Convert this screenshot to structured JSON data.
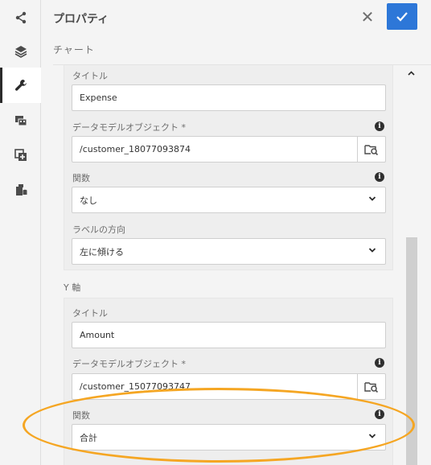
{
  "rail": {
    "items": [
      {
        "icon": "share-icon"
      },
      {
        "icon": "layers-icon"
      },
      {
        "icon": "wrench-icon"
      },
      {
        "icon": "media-icon"
      },
      {
        "icon": "add-component-icon"
      },
      {
        "icon": "data-icon"
      }
    ],
    "active_index": 2
  },
  "header": {
    "title": "プロパティ",
    "close_label": "✕",
    "confirm_label": "✓"
  },
  "section_tab": "チャート",
  "x_axis": {
    "title_label": "タイトル",
    "title_value": "Expense",
    "dmo_label": "データモデルオブジェクト *",
    "dmo_value": "/customer_18077093874",
    "func_label": "関数",
    "func_value": "なし",
    "label_dir_label": "ラベルの方向",
    "label_dir_value": "左に傾ける"
  },
  "y_axis": {
    "heading": "Y 軸",
    "title_label": "タイトル",
    "title_value": "Amount",
    "dmo_label": "データモデルオブジェクト *",
    "dmo_value": "/customer_15077093747",
    "func_label": "関数",
    "func_value": "合計"
  },
  "colors": {
    "accent": "#2d77d8",
    "highlight": "#f5a623"
  }
}
